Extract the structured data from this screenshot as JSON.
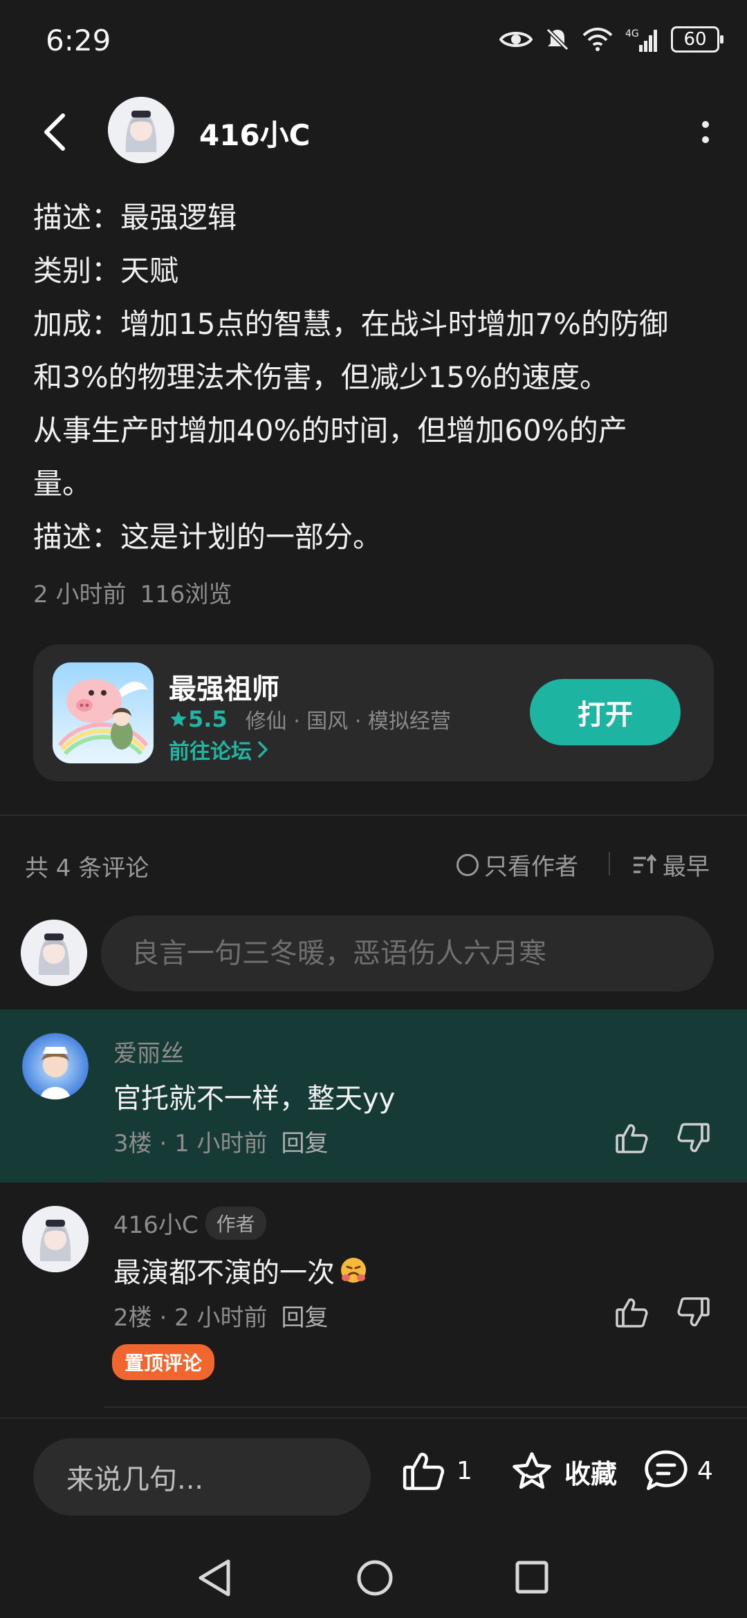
{
  "status_bar": {
    "time": "6:29",
    "battery": "60",
    "network": "4G"
  },
  "header": {
    "title": "416小C"
  },
  "post": {
    "lines": [
      "描述：最强逻辑",
      "类别：天赋",
      "加成：增加15点的智慧，在战斗时增加7%的防御",
      "和3%的物理法术伤害，但减少15%的速度。",
      "从事生产时增加40%的时间，但增加60%的产",
      "量。",
      "描述：这是计划的一部分。"
    ],
    "time_ago": "2 小时前",
    "views": "116浏览"
  },
  "app_card": {
    "name": "最强祖师",
    "rating": "5.5",
    "tags": "修仙 · 国风 · 模拟经营",
    "forum_link": "前往论坛",
    "open_label": "打开"
  },
  "comments_section": {
    "count_label": "共 4 条评论",
    "only_author_label": "只看作者",
    "sort_label": "最早",
    "input_placeholder": "良言一句三冬暖，恶语伤人六月寒"
  },
  "comments": [
    {
      "user": "爱丽丝",
      "text": "官托就不一样，整天yy",
      "floor": "3楼",
      "time": "1 小时前",
      "reply": "回复"
    },
    {
      "user": "416小C",
      "author_tag": "作者",
      "text": "最演都不演的一次",
      "floor": "2楼",
      "time": "2 小时前",
      "reply": "回复",
      "pinned_label": "置顶评论"
    }
  ],
  "bottom_bar": {
    "input_placeholder": "来说几句...",
    "like_count": "1",
    "favorite_label": "收藏",
    "comment_count": "4"
  },
  "colors": {
    "accent": "#1db4a1",
    "pin": "#f0662e",
    "highlight": "#163b37"
  }
}
